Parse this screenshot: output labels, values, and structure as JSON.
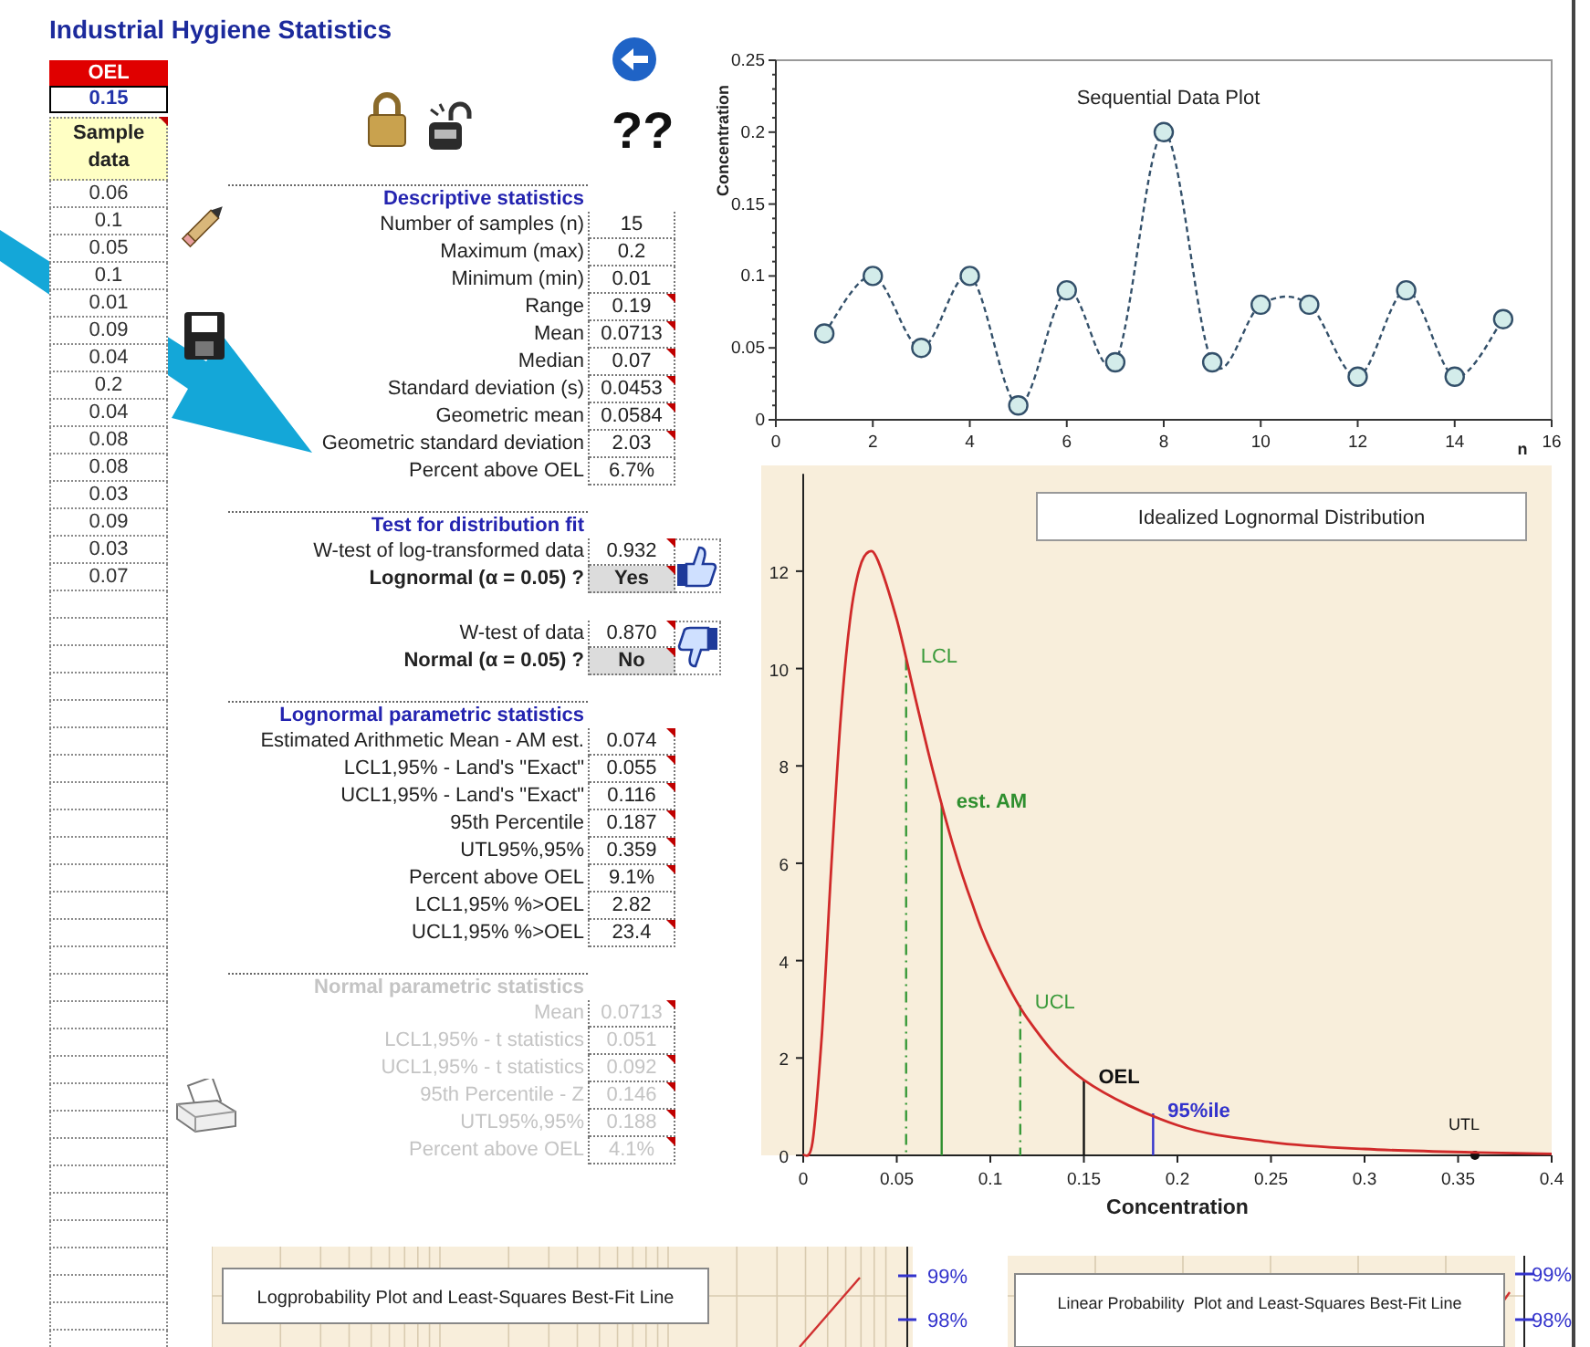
{
  "title": "Industrial Hygiene Statistics",
  "oel": {
    "label": "OEL",
    "value": "0.15"
  },
  "sample_data": {
    "header": "Sample data",
    "comment": true,
    "values": [
      "0.06",
      "0.1",
      "0.05",
      "0.1",
      "0.01",
      "0.09",
      "0.04",
      "0.2",
      "0.04",
      "0.08",
      "0.08",
      "0.03",
      "0.09",
      "0.03",
      "0.07"
    ]
  },
  "help_label": "??",
  "sections": [
    {
      "kind": "stats",
      "title": "Descriptive statistics",
      "disabled": false,
      "rows": [
        {
          "kind": "plain",
          "label": "Number of samples (n)",
          "value": "15",
          "comment": false
        },
        {
          "kind": "plain",
          "label": "Maximum (max)",
          "value": "0.2",
          "comment": false
        },
        {
          "kind": "plain",
          "label": "Minimum (min)",
          "value": "0.01",
          "comment": false
        },
        {
          "kind": "plain",
          "label": "Range",
          "value": "0.19",
          "comment": true
        },
        {
          "kind": "plain",
          "label": "Mean",
          "value": "0.0713",
          "comment": true
        },
        {
          "kind": "plain",
          "label": "Median",
          "value": "0.07",
          "comment": true
        },
        {
          "kind": "plain",
          "label": "Standard deviation (s)",
          "value": "0.0453",
          "comment": true
        },
        {
          "kind": "plain",
          "label": "Geometric mean",
          "value": "0.0584",
          "comment": true
        },
        {
          "kind": "plain",
          "label": "Geometric standard deviation",
          "value": "2.03",
          "comment": true
        },
        {
          "kind": "plain",
          "label": "Percent above OEL",
          "value": "6.7%",
          "comment": false
        }
      ]
    },
    {
      "kind": "fit",
      "title": "Test for distribution fit",
      "disabled": false,
      "groups": [
        {
          "passed": true,
          "rows": [
            {
              "kind": "plain",
              "label": "W-test of log-transformed data",
              "value": "0.932",
              "comment": true
            },
            {
              "kind": "verdict",
              "label": "Lognormal (α = 0.05) ?",
              "value": "Yes",
              "comment": true
            }
          ]
        },
        {
          "passed": false,
          "rows": [
            {
              "kind": "plain",
              "label": "W-test of data",
              "value": "0.870",
              "comment": true
            },
            {
              "kind": "verdict",
              "label": "Normal (α = 0.05) ?",
              "value": "No",
              "comment": true
            }
          ]
        }
      ]
    },
    {
      "kind": "stats",
      "title": "Lognormal parametric statistics",
      "disabled": false,
      "rows": [
        {
          "kind": "plain",
          "label": "Estimated Arithmetic Mean - AM est.",
          "value": "0.074",
          "comment": true
        },
        {
          "kind": "plain",
          "label": "LCL1,95% - Land's \"Exact\"",
          "value": "0.055",
          "comment": true
        },
        {
          "kind": "plain",
          "label": "UCL1,95% - Land's \"Exact\"",
          "value": "0.116",
          "comment": true
        },
        {
          "kind": "plain",
          "label": "95th Percentile",
          "value": "0.187",
          "comment": true
        },
        {
          "kind": "plain",
          "label": "UTL95%,95%",
          "value": "0.359",
          "comment": true
        },
        {
          "kind": "plain",
          "label": "Percent above OEL",
          "value": "9.1%",
          "comment": true
        },
        {
          "kind": "plain",
          "label": "LCL1,95% %>OEL",
          "value": "2.82",
          "comment": false
        },
        {
          "kind": "plain",
          "label": "UCL1,95% %>OEL",
          "value": "23.4",
          "comment": true
        }
      ]
    },
    {
      "kind": "stats",
      "title": "Normal parametric statistics",
      "disabled": true,
      "rows": [
        {
          "kind": "plain",
          "label": "Mean",
          "value": "0.0713",
          "comment": true
        },
        {
          "kind": "plain",
          "label": "LCL1,95% - t statistics",
          "value": "0.051",
          "comment": false
        },
        {
          "kind": "plain",
          "label": "UCL1,95% - t statistics",
          "value": "0.092",
          "comment": true
        },
        {
          "kind": "plain",
          "label": "95th Percentile - Z",
          "value": "0.146",
          "comment": true
        },
        {
          "kind": "plain",
          "label": "UTL95%,95%",
          "value": "0.188",
          "comment": true
        },
        {
          "kind": "plain",
          "label": "Percent above OEL",
          "value": "4.1%",
          "comment": true
        }
      ]
    }
  ],
  "sequential_chart": {
    "chart_data": {
      "type": "line",
      "title": "Sequential Data Plot",
      "xlabel": "n",
      "ylabel": "Concentration",
      "x": [
        1,
        2,
        3,
        4,
        5,
        6,
        7,
        8,
        9,
        10,
        11,
        12,
        13,
        14,
        15
      ],
      "series": [
        {
          "color": "#33506a",
          "line_style": "dashed",
          "marker": "circle",
          "values": [
            0.06,
            0.1,
            0.05,
            0.1,
            0.01,
            0.09,
            0.04,
            0.2,
            0.04,
            0.08,
            0.08,
            0.03,
            0.09,
            0.03,
            0.07
          ]
        }
      ],
      "xlim": [
        0,
        16
      ],
      "ylim": [
        0,
        0.25
      ],
      "xticks": [
        0,
        2,
        4,
        6,
        8,
        10,
        12,
        14,
        16
      ],
      "yticks": [
        0,
        0.05,
        0.1,
        0.15,
        0.2,
        0.25
      ]
    }
  },
  "lognormal_chart": {
    "chart_data": {
      "type": "line",
      "title": "Idealized Lognormal Distribution",
      "xlabel": "Concentration",
      "x": [
        0,
        0.005,
        0.01,
        0.015,
        0.02,
        0.025,
        0.03,
        0.035,
        0.04,
        0.05,
        0.06,
        0.07,
        0.08,
        0.09,
        0.1,
        0.12,
        0.15,
        0.2,
        0.25,
        0.3,
        0.36,
        0.4
      ],
      "series": [
        {
          "color": "#d02a2a",
          "line_style": "solid",
          "values": [
            0,
            0.27,
            2.52,
            5.94,
            8.96,
            10.98,
            12.05,
            12.4,
            12.21,
            11.0,
            9.38,
            7.79,
            6.38,
            5.2,
            4.22,
            2.8,
            1.55,
            0.62,
            0.27,
            0.13,
            0.06,
            0.03
          ]
        }
      ],
      "xlim": [
        0,
        0.4
      ],
      "ylim": [
        0,
        14
      ],
      "xticks": [
        0,
        0.05,
        0.1,
        0.15,
        0.2,
        0.25,
        0.3,
        0.35,
        0.4
      ],
      "yticks": [
        0,
        2,
        4,
        6,
        8,
        10,
        12
      ],
      "ref_lines": [
        {
          "axis": "x",
          "value": 0.055,
          "label": "LCL",
          "color": "#3a9a3a",
          "line_style": "dashdot"
        },
        {
          "axis": "x",
          "value": 0.074,
          "label": "est. AM",
          "color": "#2f8f2f",
          "line_style": "solid"
        },
        {
          "axis": "x",
          "value": 0.116,
          "label": "UCL",
          "color": "#3a9a3a",
          "line_style": "dashdot"
        },
        {
          "axis": "x",
          "value": 0.15,
          "label": "OEL",
          "color": "#111111",
          "line_style": "solid"
        },
        {
          "axis": "x",
          "value": 0.187,
          "label": "95%ile",
          "color": "#3333cc",
          "line_style": "solid"
        }
      ],
      "annotations": [
        {
          "text": "UTL",
          "x": 0.359,
          "y": 0
        }
      ]
    }
  },
  "probability_plots": [
    {
      "kind": "log",
      "title": "Logprobability Plot and Least-Squares Best-Fit Line",
      "tick_labels": [
        "99%",
        "98%"
      ]
    },
    {
      "kind": "linear",
      "title": "Linear Probability  Plot and Least-Squares Best-Fit Line",
      "tick_labels": [
        "99%",
        "98%"
      ]
    }
  ]
}
